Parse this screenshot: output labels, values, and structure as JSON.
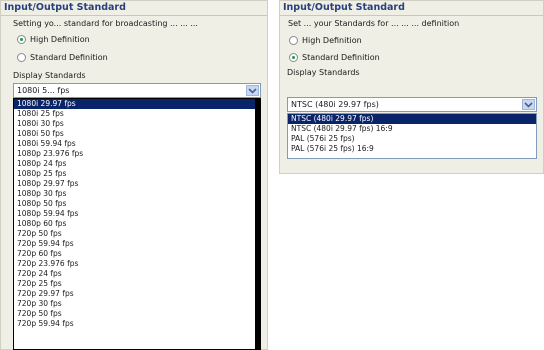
{
  "left": {
    "title": "Input/Output Standard",
    "description": "Setting yo... standard for broadcasting ... ... ...",
    "radio_hd": "High Definition",
    "radio_sd": "Standard Definition",
    "display_label": "Display Standards",
    "combo_value": "1080i 5... fps",
    "items": [
      "1080i 29.97 fps",
      "1080i 25 fps",
      "1080i 30 fps",
      "1080i 50 fps",
      "1080i 59.94 fps",
      "1080p 23.976 fps",
      "1080p 24 fps",
      "1080p 25 fps",
      "1080p 29.97 fps",
      "1080p 30 fps",
      "1080p 50 fps",
      "1080p 59.94 fps",
      "1080p 60 fps",
      "720p 50 fps",
      "720p 59.94 fps",
      "720p 60 fps",
      "720p 23.976 fps",
      "720p 24 fps",
      "720p 25 fps",
      "720p 29.97 fps",
      "720p 30 fps",
      "720p 50 fps",
      "720p 59.94 fps"
    ],
    "selected_index": 0
  },
  "right": {
    "title": "Input/Output Standard",
    "description": "Set ... your Standards for ... ... ... definition",
    "radio_hd": "High Definition",
    "radio_sd": "Standard Definition",
    "display_label": "Display Standards",
    "combo_value": "NTSC (480i 29.97 fps)",
    "items": [
      "NTSC (480i 29.97 fps)",
      "NTSC (480i 29.97 fps) 16:9",
      "PAL (576i 25 fps)",
      "PAL (576i 25 fps) 16:9"
    ],
    "selected_index": 0
  },
  "icons": {
    "combo_arrow": "chevron-down-icon"
  }
}
